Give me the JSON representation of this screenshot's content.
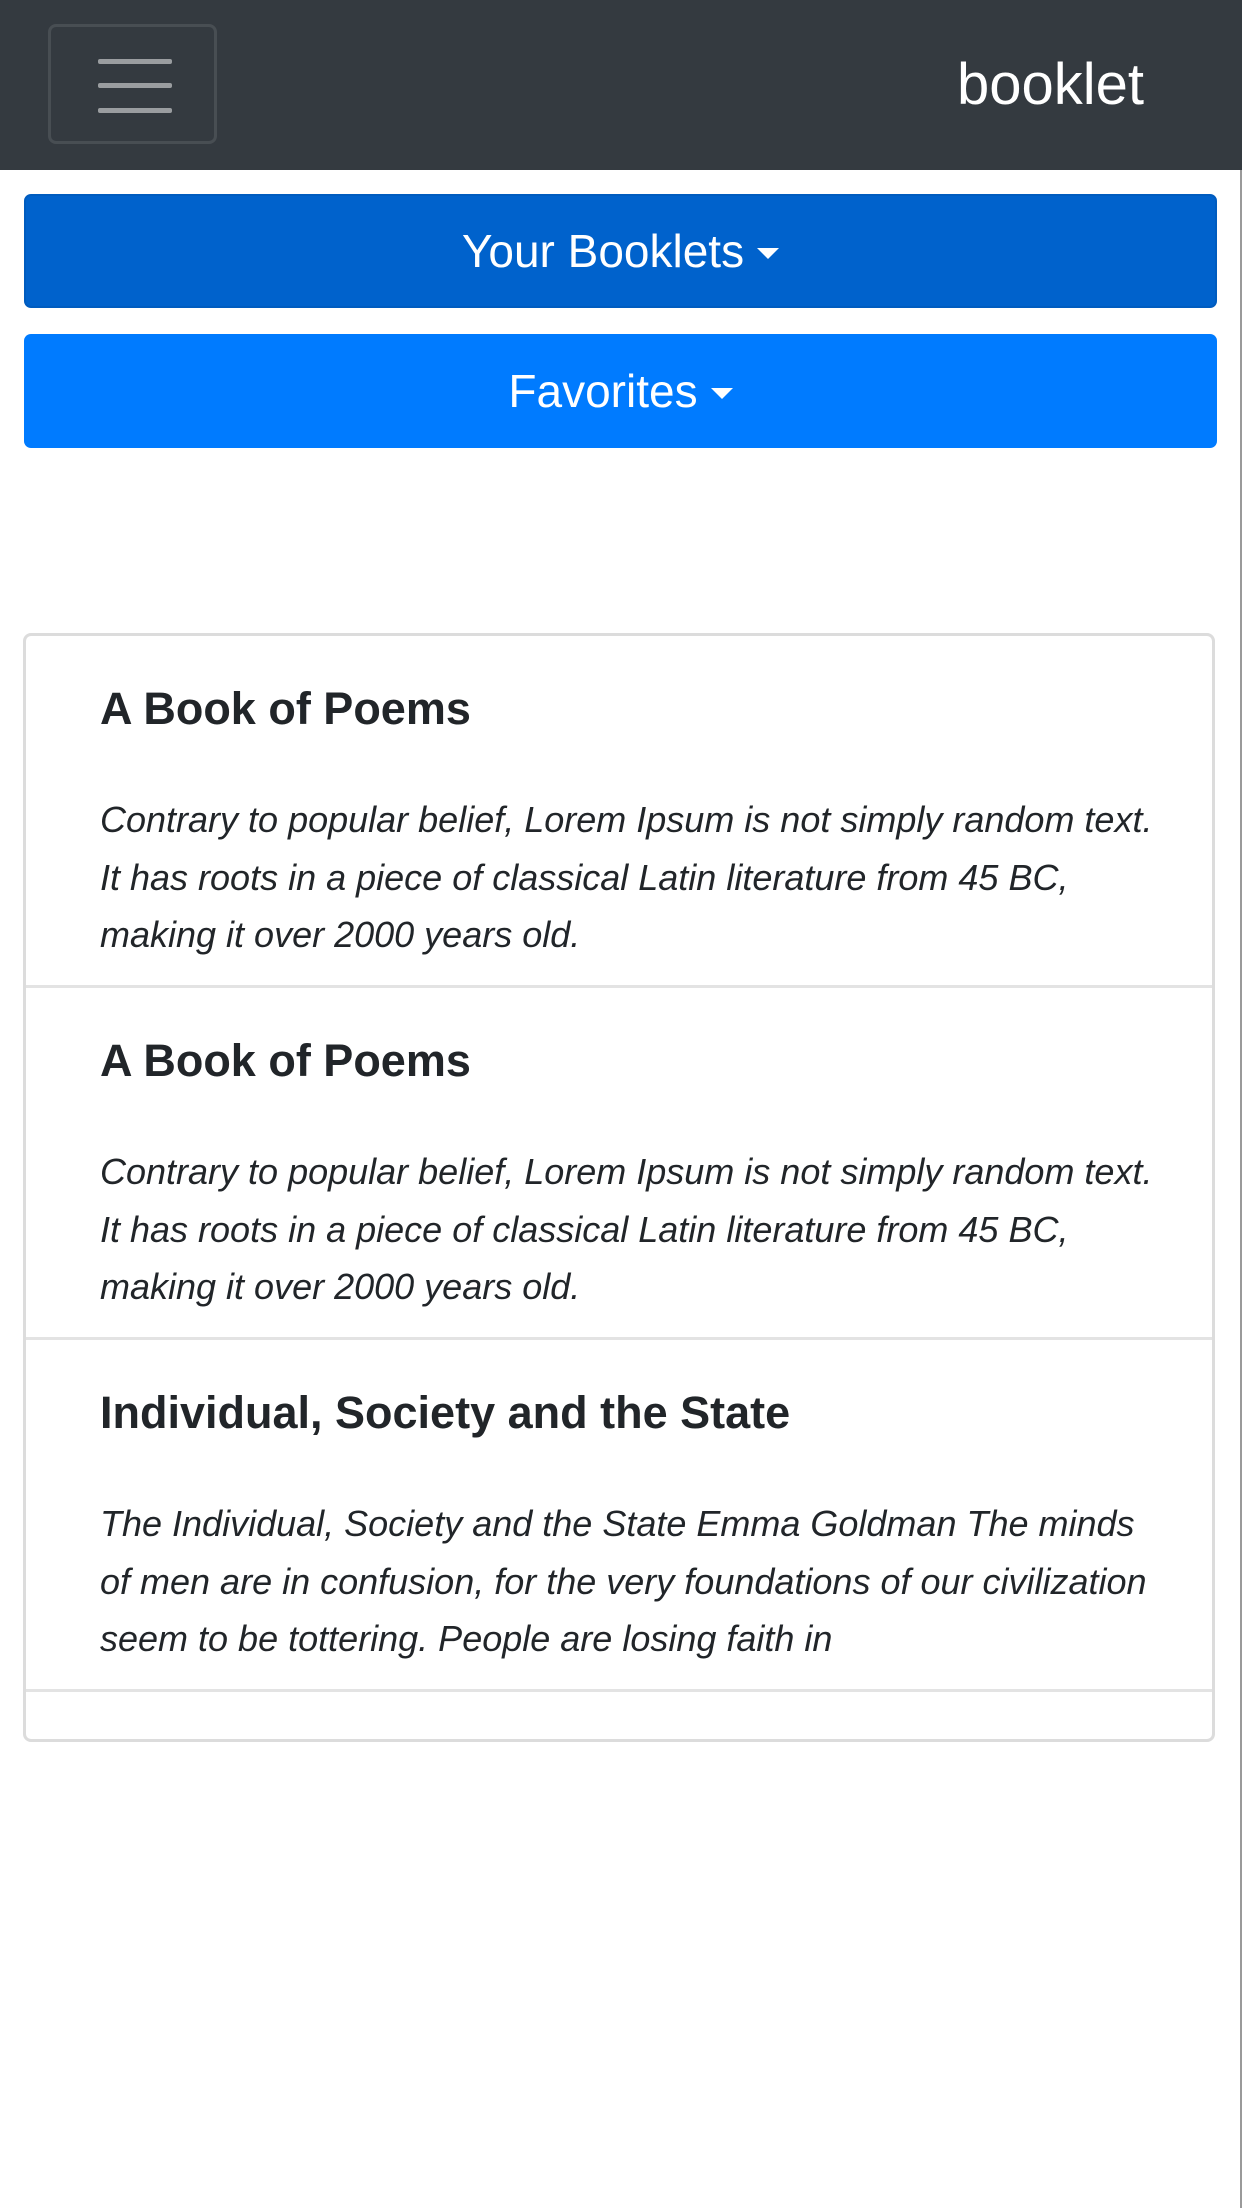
{
  "navbar": {
    "brand": "booklet",
    "toggle_icon": "hamburger-menu-icon"
  },
  "dropdowns": {
    "booklets_label": "Your Booklets",
    "favorites_label": "Favorites"
  },
  "colors": {
    "navbar_bg": "#343a40",
    "booklets_btn": "#0062cc",
    "favorites_btn": "#007bff"
  },
  "booklets": [
    {
      "title": "A Book of Poems",
      "description": "Contrary to popular belief, Lorem Ipsum is not simply random text. It has roots in a piece of classical Latin literature from 45 BC, making it over 2000 years old."
    },
    {
      "title": "A Book of Poems",
      "description": "Contrary to popular belief, Lorem Ipsum is not simply random text. It has roots in a piece of classical Latin literature from 45 BC, making it over 2000 years old."
    },
    {
      "title": "Individual, Society and the State",
      "description": "The Individual, Society and the State Emma Goldman The minds of men are in confusion, for the very foundations of our civilization seem to be tottering. People are losing faith in"
    }
  ]
}
